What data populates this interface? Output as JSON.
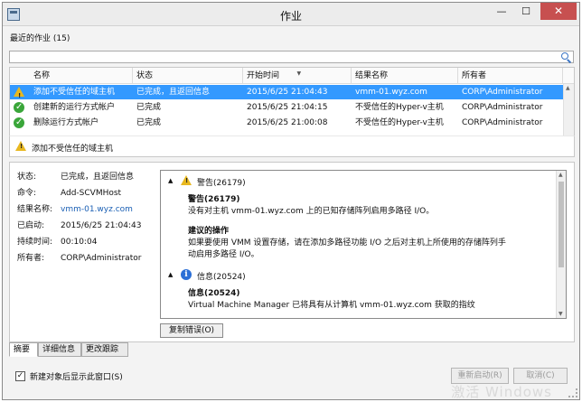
{
  "window": {
    "title": "作业",
    "min_glyph": "—",
    "max_glyph": "☐",
    "close_glyph": "✕"
  },
  "recent_label": "最近的作业 (15)",
  "table": {
    "headers": [
      "名称",
      "状态",
      "开始时间",
      "结果名称",
      "所有者"
    ],
    "sorted_column": "开始时间",
    "rows": [
      {
        "icon": "warning-icon",
        "name": "添加不受信任的域主机",
        "status": "已完成，且返回信息",
        "start": "2015/6/25 21:04:43",
        "result": "vmm-01.wyz.com",
        "owner": "CORP\\Administrator",
        "selected": true
      },
      {
        "icon": "success-icon",
        "name": "创建新的运行方式帐户",
        "status": "已完成",
        "start": "2015/6/25 21:04:15",
        "result": "不受信任的Hyper-v主机",
        "owner": "CORP\\Administrator",
        "selected": false
      },
      {
        "icon": "success-icon",
        "name": "删除运行方式帐户",
        "status": "已完成",
        "start": "2015/6/25 21:00:08",
        "result": "不受信任的Hyper-v主机",
        "owner": "CORP\\Administrator",
        "selected": false
      }
    ]
  },
  "selected_job_label": "添加不受信任的域主机",
  "properties": [
    {
      "k": "状态:",
      "v": "已完成，且返回信息"
    },
    {
      "k": "命令:",
      "v": "Add-SCVMHost"
    },
    {
      "k": "结果名称:",
      "v": "vmm-01.wyz.com"
    },
    {
      "k": "已启动:",
      "v": "2015/6/25 21:04:43"
    },
    {
      "k": "持续时间:",
      "v": "00:10:04"
    },
    {
      "k": "所有者:",
      "v": "CORP\\Administrator"
    }
  ],
  "messages": {
    "warning_header": "警告(26179)",
    "warning_title": "警告(26179)",
    "warning_text": "没有对主机 vmm-01.wyz.com 上的已知存储阵列启用多路径 I/O。",
    "action_title": "建议的操作",
    "action_text_1": "如果要使用 VMM 设置存储，请在添加多路径功能 I/O 之后对主机上所使用的存储阵列手",
    "action_text_2": "动启用多路径 I/O。",
    "info_header": "信息(20524)",
    "info_title": "信息(20524)",
    "info_text": "Virtual Machine Manager 已将具有从计算机 vmm-01.wyz.com 获取的指纹"
  },
  "copy_error_button": "复制错误(O)",
  "tabs": [
    "摘要",
    "详细信息",
    "更改跟踪"
  ],
  "footer": {
    "checkbox_label": "新建对象后显示此窗口(S)",
    "checked": true,
    "restart_button": "重新启动(R)",
    "cancel_button": "取消(C)",
    "watermark": "激活 Windows"
  }
}
